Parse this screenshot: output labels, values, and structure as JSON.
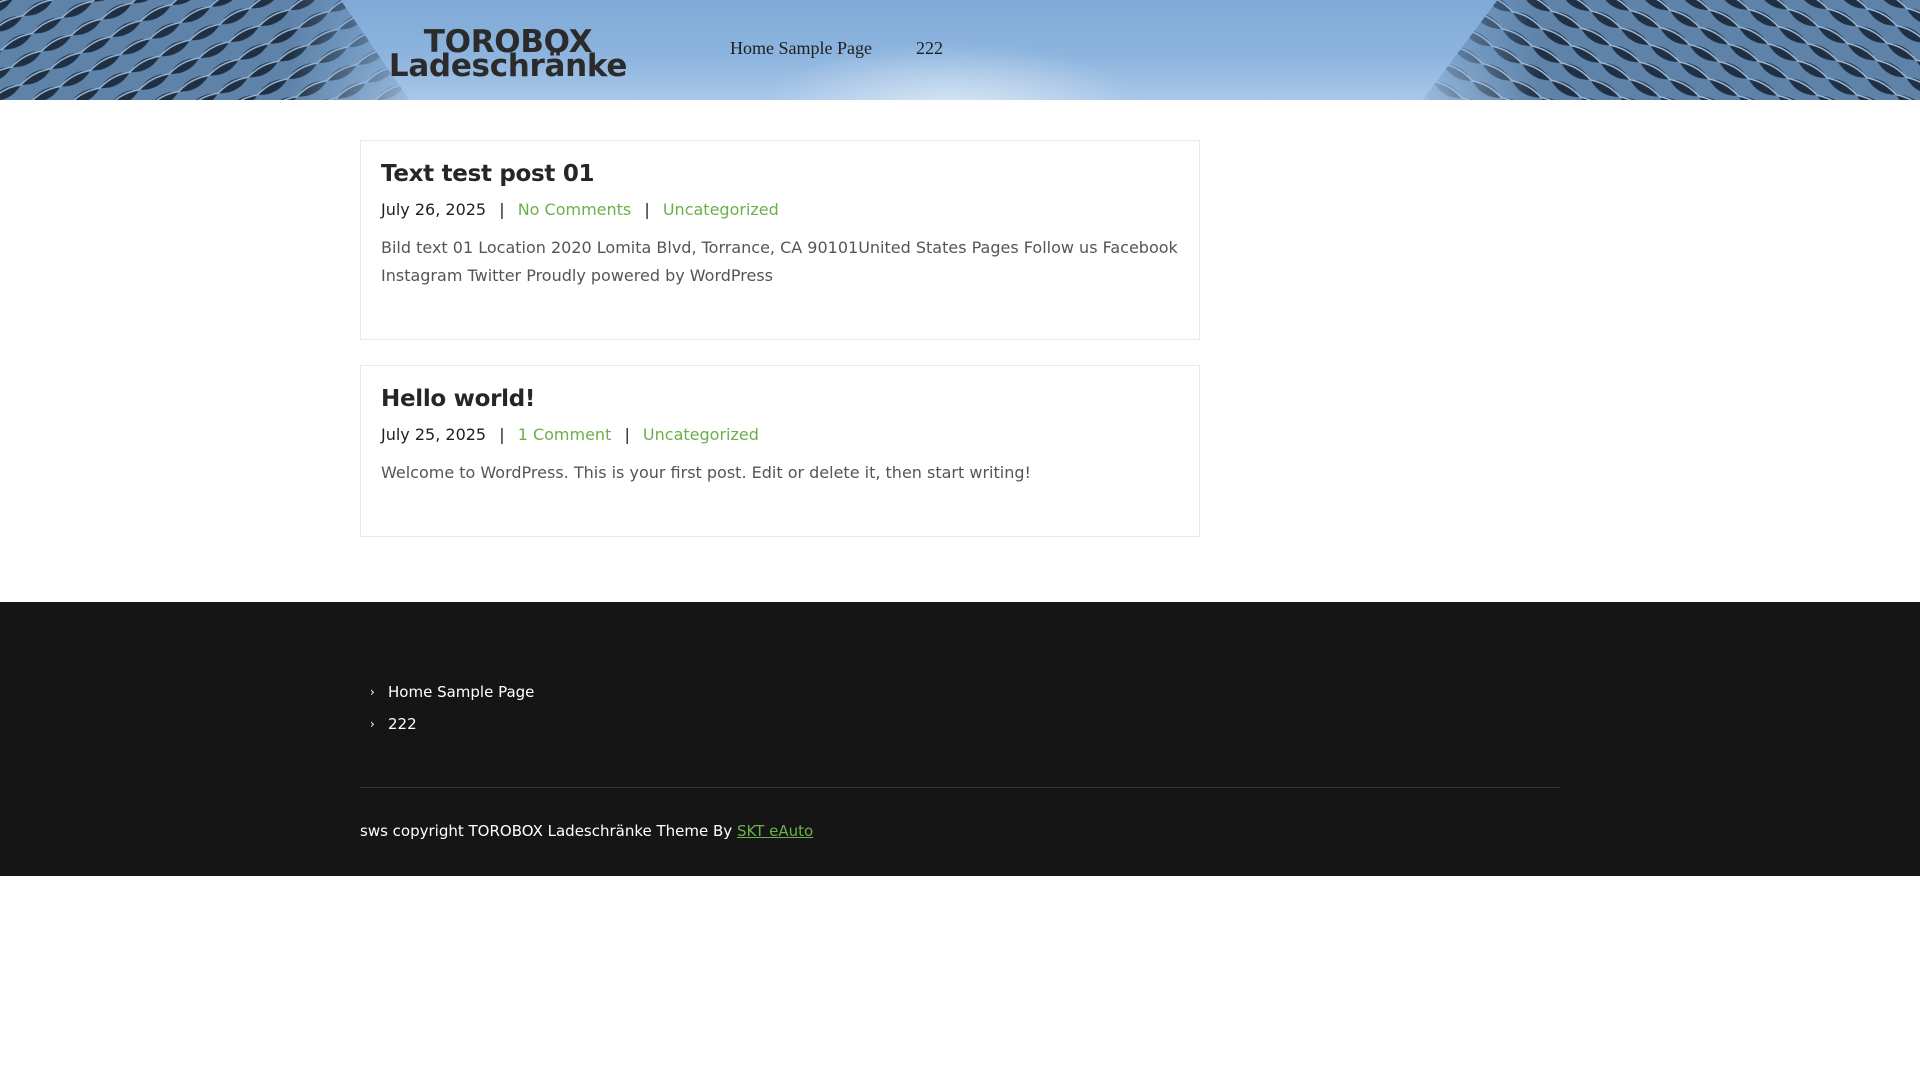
{
  "colors": {
    "accent": "#6ab04c",
    "footer_bg": "#151515",
    "sky": "#8cb4de"
  },
  "header": {
    "logo_line1": "TOROBOX",
    "logo_line2": "Ladeschränke",
    "nav": [
      {
        "label": "Home Sample Page"
      },
      {
        "label": "222"
      }
    ]
  },
  "posts": [
    {
      "title": "Text test post 01",
      "date": "July 26, 2025",
      "comments": "No Comments",
      "category": "Uncategorized",
      "excerpt": "Bild text 01 Location 2020 Lomita Blvd, Torrance, CA 90101United States Pages Follow us Facebook Instagram Twitter Proudly powered by WordPress"
    },
    {
      "title": "Hello world!",
      "date": "July 25, 2025",
      "comments": "1 Comment",
      "category": "Uncategorized",
      "excerpt": "Welcome to WordPress. This is your first post. Edit or delete it, then start writing!"
    }
  ],
  "meta_separator": "|",
  "footer": {
    "chevron": "›",
    "menu": [
      {
        "label": "Home Sample Page"
      },
      {
        "label": "222"
      }
    ],
    "copyright_text": "sws copyright TOROBOX Ladeschränke Theme By",
    "theme_link": "SKT eAuto"
  }
}
